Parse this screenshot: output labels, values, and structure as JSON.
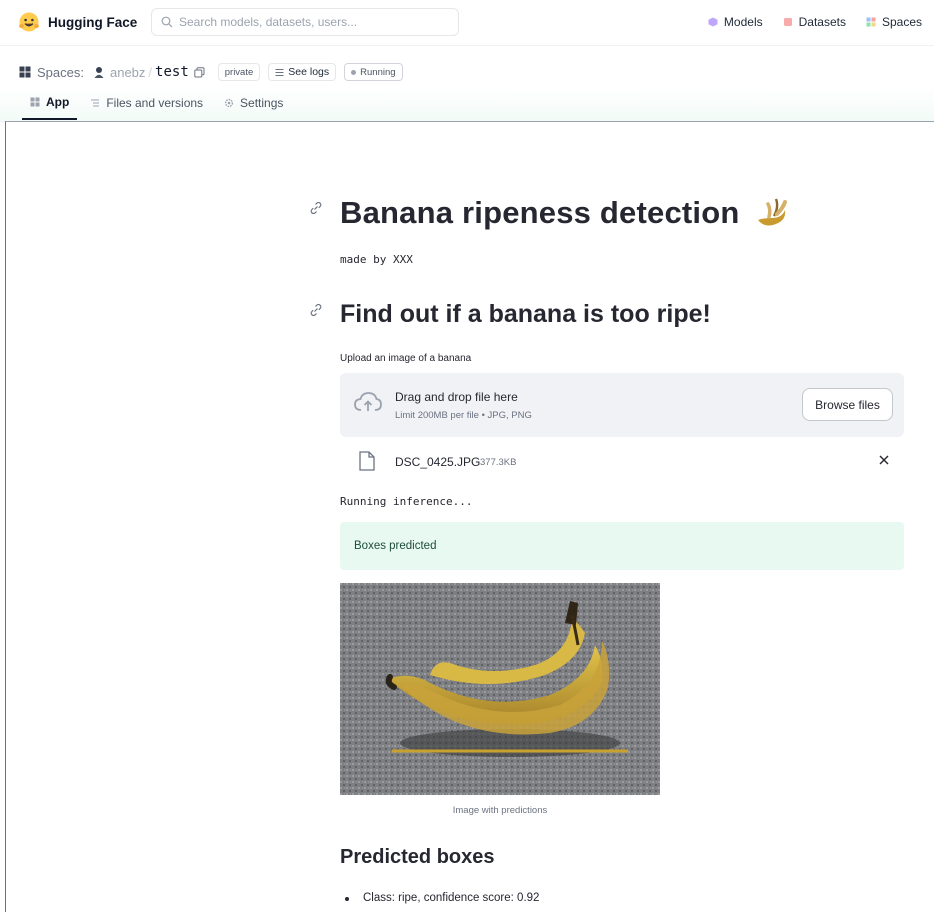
{
  "brand": {
    "name": "Hugging Face"
  },
  "search": {
    "placeholder": "Search models, datasets, users..."
  },
  "nav": {
    "models": "Models",
    "datasets": "Datasets",
    "spaces": "Spaces"
  },
  "space": {
    "section_label": "Spaces:",
    "owner": "anebz",
    "separator": "/",
    "repo": "test",
    "visibility_tag": "private",
    "logs_label": "See logs",
    "status": "Running"
  },
  "tabs": [
    {
      "label": "App",
      "active": true
    },
    {
      "label": "Files and versions",
      "active": false
    },
    {
      "label": "Settings",
      "active": false
    }
  ],
  "app": {
    "title": "Banana ripeness detection",
    "made_by": "made by XXX",
    "subtitle": "Find out if a banana is too ripe!",
    "upload_label": "Upload an image of a banana",
    "dropzone": {
      "title": "Drag and drop file here",
      "limits": "Limit 200MB per file • JPG, PNG",
      "browse_label": "Browse files"
    },
    "file": {
      "name": "DSC_0425.JPG",
      "size": "377.3KB"
    },
    "running_text": "Running inference...",
    "success_text": "Boxes predicted",
    "image_caption": "Image with predictions",
    "predicted_heading": "Predicted boxes",
    "predictions": [
      "Class: ripe, confidence score: 0.92"
    ]
  },
  "colors": {
    "brand_yellow": "#ffcc4d",
    "success_bg": "#e8f9f1",
    "dropzone_bg": "#f0f2f6",
    "text_dark": "#262730"
  }
}
